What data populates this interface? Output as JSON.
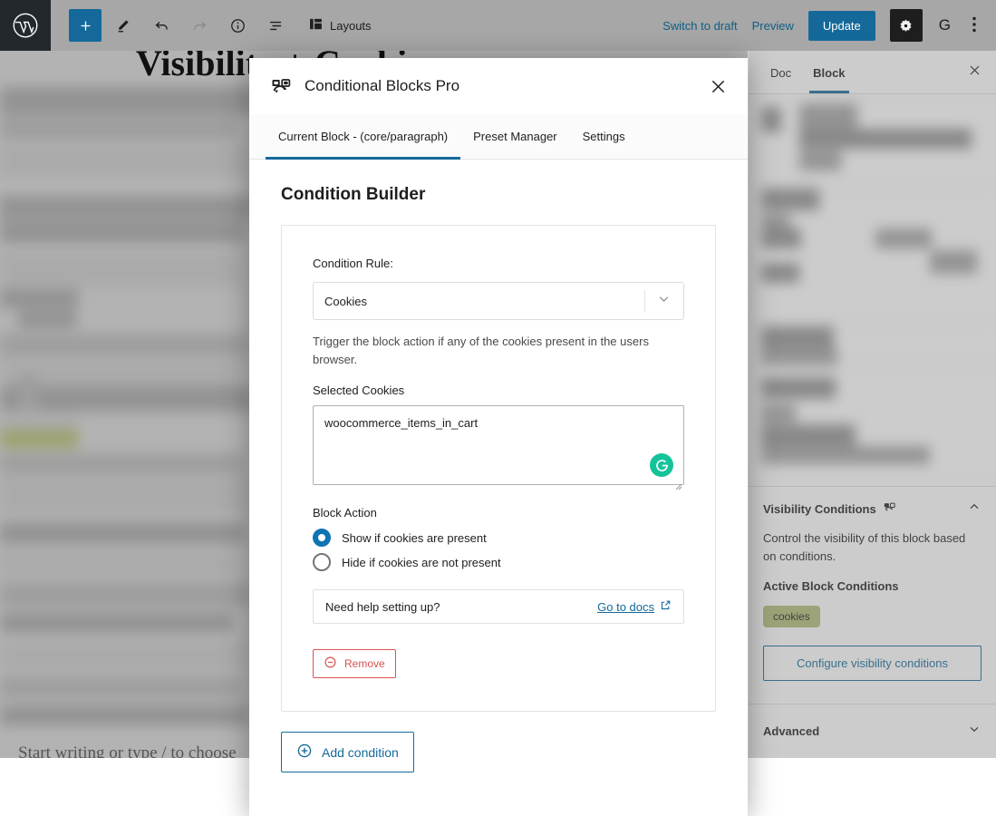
{
  "adminbar": {
    "logo_icon": "wordpress-logo-icon",
    "tools": [
      {
        "icon": "add-block-icon",
        "name": "add-block-button",
        "label": "+"
      },
      {
        "icon": "edit-pencil-icon",
        "name": "tools-edit-button",
        "label": ""
      },
      {
        "icon": "undo-arrow-icon",
        "name": "undo-button",
        "label": ""
      },
      {
        "icon": "redo-arrow-icon",
        "name": "redo-button",
        "label": ""
      },
      {
        "icon": "info-circle-icon",
        "name": "details-button",
        "label": ""
      },
      {
        "icon": "list-view-icon",
        "name": "list-view-button",
        "label": ""
      }
    ],
    "layouts_label": "Layouts",
    "layouts_icon": "layouts-icon",
    "switch_to_draft": "Switch to draft",
    "preview": "Preview",
    "update": "Update",
    "settings_icon": "gear-icon",
    "grammarly_icon": "grammarly-g-icon",
    "more_icon": "more-vertical-icon",
    "accent": "#14699a"
  },
  "canvas": {
    "post_title": "Visibility + Cookies",
    "placeholder": "Start writing or type / to choose"
  },
  "sidebar": {
    "tabs": [
      {
        "label": "Doc",
        "active": false
      },
      {
        "label": "Block",
        "active": true
      }
    ],
    "close_icon": "close-icon",
    "visibility": {
      "title": "Visibility Conditions",
      "icon": "conditional-blocks-icon",
      "chevron": "chevron-up-icon",
      "description": "Control the visibility of this block based on conditions.",
      "active_heading": "Active Block Conditions",
      "tags": [
        "cookies"
      ],
      "tag_color": "#b4bd78",
      "configure_label": "Configure visibility conditions"
    },
    "advanced": {
      "title": "Advanced",
      "chevron": "chevron-down-icon"
    }
  },
  "modal": {
    "title": "Conditional Blocks Pro",
    "logo_icon": "conditional-blocks-icon",
    "close_icon": "close-icon",
    "tabs": [
      {
        "label": "Current Block - (core/paragraph)",
        "active": true
      },
      {
        "label": "Preset Manager",
        "active": false
      },
      {
        "label": "Settings",
        "active": false
      }
    ],
    "heading": "Condition Builder",
    "condition": {
      "rule_label": "Condition Rule:",
      "rule_value": "Cookies",
      "rule_chevron": "chevron-down-icon",
      "rule_help": "Trigger the block action if any of the cookies present in the users browser.",
      "cookies_label": "Selected Cookies",
      "cookies_value": "woocommerce_items_in_cart",
      "grammarly_icon": "grammarly-icon",
      "resize_handle": "resize-grip-icon",
      "block_action_label": "Block Action",
      "options": [
        {
          "label": "Show if cookies are present",
          "checked": true
        },
        {
          "label": "Hide if cookies are not present",
          "checked": false
        }
      ],
      "help_question": "Need help setting up?",
      "help_link": "Go to docs",
      "help_link_icon": "external-link-icon",
      "remove_label": "Remove",
      "remove_icon": "minus-circle-icon",
      "remove_color": "#d9534f"
    },
    "add_condition_label": "Add condition",
    "add_condition_icon": "plus-circle-icon"
  }
}
